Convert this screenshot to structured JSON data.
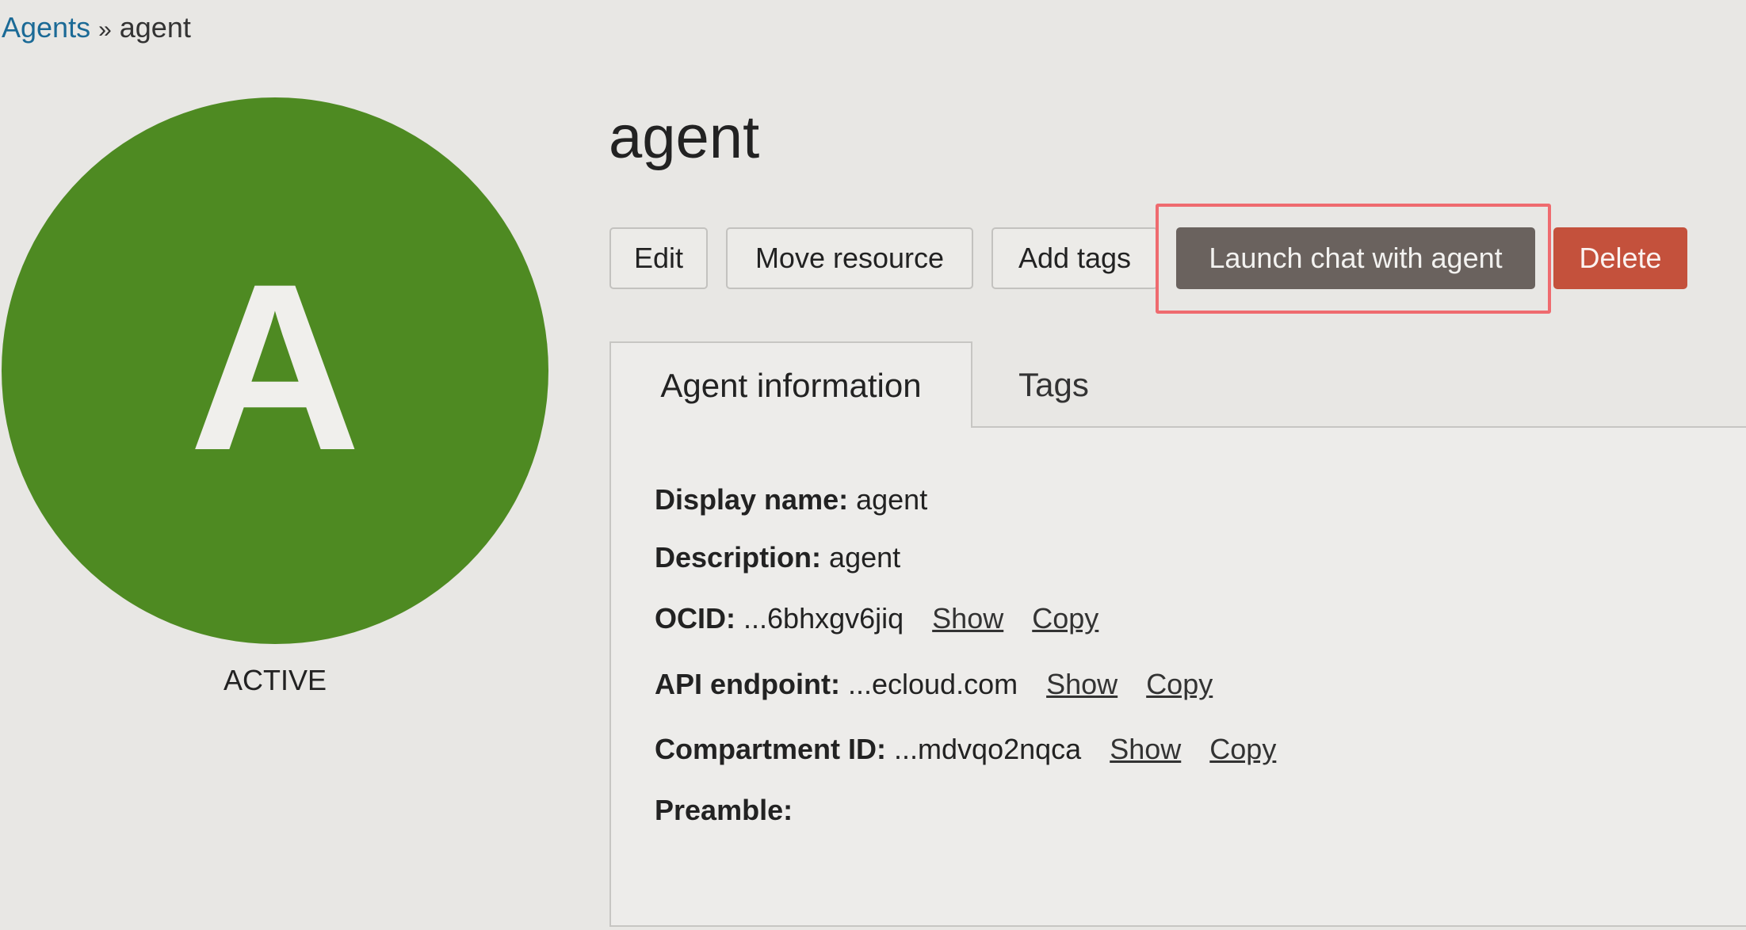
{
  "breadcrumb": {
    "parent": "Agents",
    "separator": "»",
    "current": "agent"
  },
  "avatar": {
    "letter": "A",
    "color": "#4e8a22",
    "status": "ACTIVE"
  },
  "page": {
    "title": "agent"
  },
  "actions": {
    "edit": "Edit",
    "move": "Move resource",
    "add_tags": "Add tags",
    "launch_chat": "Launch chat with agent",
    "delete": "Delete"
  },
  "tabs": [
    {
      "label": "Agent information",
      "active": true
    },
    {
      "label": "Tags",
      "active": false
    }
  ],
  "info": {
    "display_name": {
      "label": "Display name:",
      "value": "agent"
    },
    "description": {
      "label": "Description:",
      "value": "agent"
    },
    "ocid": {
      "label": "OCID:",
      "value": "...6bhxgv6jiq",
      "show": "Show",
      "copy": "Copy"
    },
    "api_endpoint": {
      "label": "API endpoint:",
      "value": "...ecloud.com",
      "show": "Show",
      "copy": "Copy"
    },
    "compartment_id": {
      "label": "Compartment ID:",
      "value": "...mdvqo2nqca",
      "show": "Show",
      "copy": "Copy"
    },
    "preamble": {
      "label": "Preamble:",
      "value": ""
    }
  },
  "colors": {
    "launch_button": "#6a625e",
    "delete_button": "#c4513c",
    "highlight": "#ef6b6f",
    "link": "#1b6a96"
  }
}
